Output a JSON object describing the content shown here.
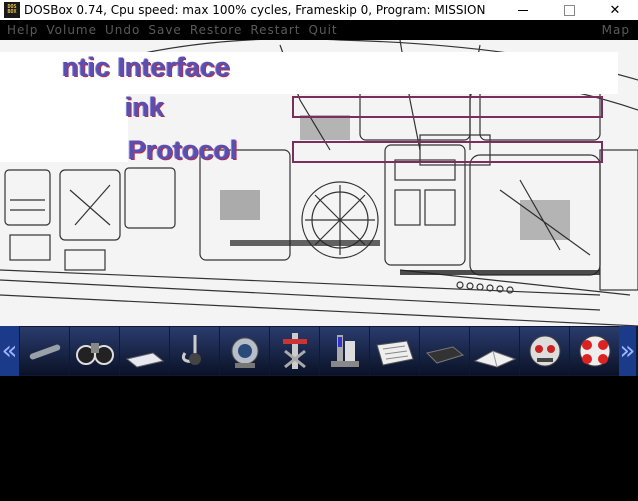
{
  "window": {
    "title": "DOSBox 0.74, Cpu speed: max 100% cycles, Frameskip  0, Program:  MISSION",
    "icon_text": [
      "DOS",
      "BOX"
    ],
    "controls": {
      "minimize": "–",
      "maximize": "☐",
      "close": "✕"
    }
  },
  "menu": {
    "items": [
      "Help",
      "Volume",
      "Undo",
      "Save",
      "Restore",
      "Restart",
      "Quit"
    ],
    "right": "Map"
  },
  "game": {
    "lines": [
      "ntic Interface",
      "ink",
      "Protocol"
    ]
  },
  "toolbar": {
    "left_arrow": "«",
    "right_arrow": "»",
    "items": [
      {
        "icon": "pipe-icon"
      },
      {
        "icon": "binoculars-icon"
      },
      {
        "icon": "paper-sheet-icon"
      },
      {
        "icon": "hook-icon"
      },
      {
        "icon": "diving-helmet-icon"
      },
      {
        "icon": "cross-tool-icon"
      },
      {
        "icon": "device-icon"
      },
      {
        "icon": "scroll-icon"
      },
      {
        "icon": "dark-box-icon"
      },
      {
        "icon": "folded-paper-icon"
      },
      {
        "icon": "robot-head-icon"
      },
      {
        "icon": "red-robot-head-icon"
      }
    ]
  },
  "colors": {
    "menu_text": "#5a5a5a",
    "label_text": "#5a4fb0",
    "field_border": "#7a2e5a",
    "toolbar_bg": "#0e1a33",
    "arrow_bg": "#1b3a8a"
  }
}
